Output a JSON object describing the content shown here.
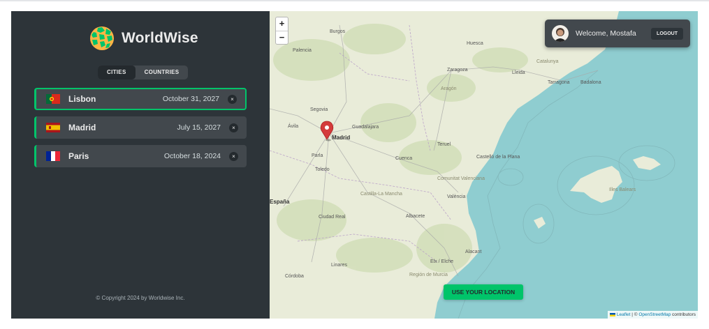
{
  "app": {
    "name": "WorldWise",
    "copyright": "© Copyright 2024 by Worldwise Inc."
  },
  "tabs": [
    {
      "label": "CITIES",
      "active": true
    },
    {
      "label": "COUNTRIES",
      "active": false
    }
  ],
  "cities": [
    {
      "name": "Lisbon",
      "date": "October 31, 2027",
      "flag": "portugal",
      "active": true,
      "delete_label": "×"
    },
    {
      "name": "Madrid",
      "date": "July 15, 2027",
      "flag": "spain",
      "active": false,
      "delete_label": "×"
    },
    {
      "name": "Paris",
      "date": "October 18, 2024",
      "flag": "france",
      "active": false,
      "delete_label": "×"
    }
  ],
  "map": {
    "zoom_in": "+",
    "zoom_out": "−",
    "use_location_label": "USE YOUR LOCATION",
    "attribution": {
      "leaflet": "Leaflet",
      "separator": " | © ",
      "osm": "OpenStreetMap",
      "suffix": " contributors"
    },
    "place_labels": {
      "burgos": "Burgos",
      "palencia": "Palencia",
      "huesca": "Huesca",
      "zaragoza": "Zaragoza",
      "lleida": "Lleida",
      "catalunya": "Catalunya",
      "tarragona": "Tarragona",
      "badalona": "Badalona",
      "aragon": "Aragón",
      "segovia": "Segovia",
      "avila": "Ávila",
      "guadalajara": "Guadalajara",
      "madrid": "Madrid",
      "parla": "Parla",
      "toledo": "Toledo",
      "teruel": "Teruel",
      "cuenca": "Cuenca",
      "castello": "Castelló de la Plana",
      "espana": "España",
      "castilla": "Castilla-La Mancha",
      "comunitat": "Comunitat Valenciana",
      "valencia": "València",
      "illes": "Illes Balears",
      "ciudad_real": "Ciudad Real",
      "albacete": "Albacete",
      "alacant": "Alacant",
      "elx": "Elx / Elche",
      "linares": "Linares",
      "murcia": "Región de Murcia",
      "cordoba": "Córdoba"
    },
    "marker_city": "Madrid"
  },
  "user": {
    "welcome": "Welcome, Mostafa",
    "logout_label": "LOGOUT"
  },
  "colors": {
    "brand_green": "#00c46a",
    "sidebar_bg": "#2d3439",
    "item_bg": "#42484d",
    "sea": "#8fcdd0",
    "land": "#e9ecd9",
    "marker": "#d43b3b"
  }
}
